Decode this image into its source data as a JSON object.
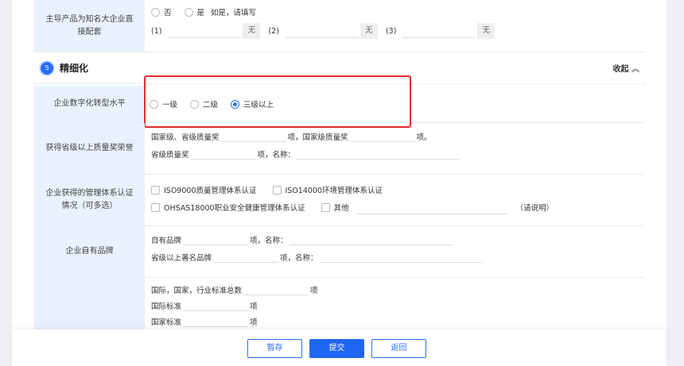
{
  "row_supply": {
    "label": "主导产品为知名大企业直接配套",
    "options": [
      "否",
      "是"
    ],
    "hint": "如是，请填写",
    "items": [
      "(1)",
      "(2)",
      "(3)"
    ],
    "suffix": "无"
  },
  "section": {
    "number": "5",
    "title": "精细化",
    "collapse": "收起"
  },
  "row_digital": {
    "label": "企业数字化转型水平",
    "options": [
      "一级",
      "二级",
      "三级以上"
    ],
    "selected": 2
  },
  "row_quality": {
    "label": "获得省级以上质量奖荣誉",
    "t1": "国家级、省级质量奖",
    "t2": "项，国家级质量奖",
    "t3": "项。",
    "t4": "省级质量奖",
    "t5": "项，名称："
  },
  "row_cert": {
    "label": "企业获得的管理体系认证情况（可多选）",
    "c1": "ISO9000质量管理体系认证",
    "c2": "ISO14000环境管理体系认证",
    "c3": "OHSAS18000职业安全健康管理体系认证",
    "c4": "其他",
    "note": "（请说明）"
  },
  "row_brand": {
    "label": "企业自有品牌",
    "t1": "自有品牌",
    "t2": "项，名称：",
    "t3": "省级以上著名品牌",
    "t4": "项，名称："
  },
  "row_std": {
    "t1": "国际，国家，行业标准总数",
    "t2": "项",
    "t3": "国际标准",
    "t4": "项",
    "t5": "国家标准",
    "t6": "项"
  },
  "footer": {
    "save": "暂存",
    "submit": "提交",
    "back": "返回"
  }
}
